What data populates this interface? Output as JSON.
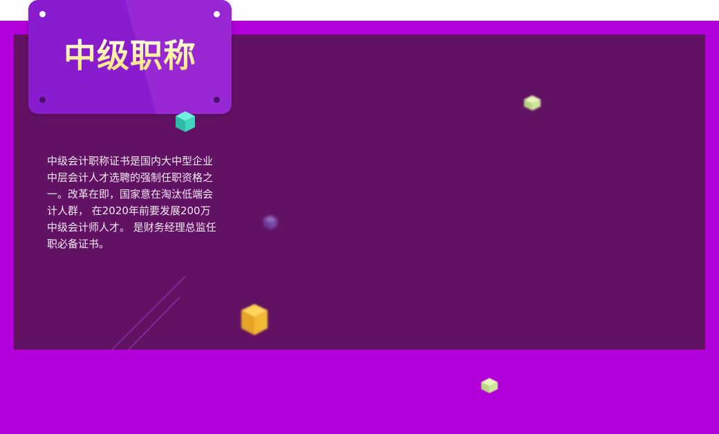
{
  "card": {
    "title": "中级职称"
  },
  "description": {
    "text": "中级会计职称证书是国内大中型企业中层会计人才选聘的强制任职资格之一。改革在即，国家意在淘汰低端会计人群， 在2020年前要发展200万中级会计师人才。 是财务经理总监任职必备证书。"
  },
  "colors": {
    "outer_band": "#b100d8",
    "inner_panel": "#621262",
    "card": "#8a1ccf",
    "title_text": "#fff4b8",
    "body_text": "#f4e9f6",
    "cube_teal": "#3fd6c0",
    "cube_gold": "#f2b935",
    "cube_lime": "#cfe79a",
    "cube_violet": "#7a4aa8"
  },
  "decorations": {
    "cubes": [
      "teal-cube-icon",
      "gold-cube-icon",
      "lime-cube-icon",
      "violet-cube-icon"
    ],
    "lines": "diagonal-lines"
  }
}
